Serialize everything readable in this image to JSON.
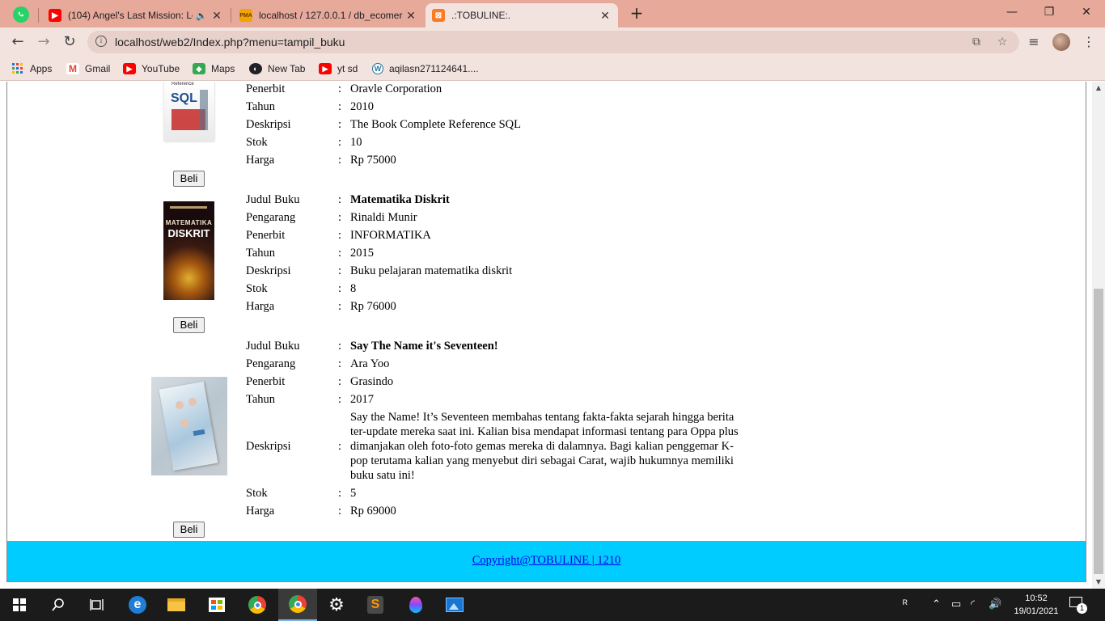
{
  "browser": {
    "tabs": [
      {
        "title": "(104) Angel's Last Mission: Lo",
        "favicon": "youtube-icon"
      },
      {
        "title": "localhost / 127.0.0.1 / db_ecomer",
        "favicon": "phpmyadmin-icon"
      },
      {
        "title": ".:TOBULINE:.",
        "favicon": "xampp-icon"
      }
    ],
    "url": "localhost/web2/Index.php?menu=tampil_buku",
    "bookmarks": [
      {
        "label": "Apps",
        "icon": "apps-grid-icon"
      },
      {
        "label": "Gmail",
        "icon": "gmail-icon"
      },
      {
        "label": "YouTube",
        "icon": "youtube-icon"
      },
      {
        "label": "Maps",
        "icon": "maps-icon"
      },
      {
        "label": "New Tab",
        "icon": "globe-icon"
      },
      {
        "label": "yt sd",
        "icon": "youtube-icon"
      },
      {
        "label": "aqilasn271124641....",
        "icon": "wordpress-icon"
      }
    ]
  },
  "books": [
    {
      "fields": [
        {
          "label": "Penerbit",
          "value": "Oravle Corporation"
        },
        {
          "label": "Tahun",
          "value": "2010"
        },
        {
          "label": "Deskripsi",
          "value": "The Book Complete Reference SQL"
        },
        {
          "label": "Stok",
          "value": "10"
        },
        {
          "label": "Harga",
          "value": "Rp 75000"
        }
      ],
      "cover_text": "SQL",
      "cover_small": "Reference",
      "buy_label": "Beli"
    },
    {
      "fields": [
        {
          "label": "Judul Buku",
          "value": "Matematika Diskrit"
        },
        {
          "label": "Pengarang",
          "value": "Rinaldi Munir"
        },
        {
          "label": "Penerbit",
          "value": "INFORMATIKA"
        },
        {
          "label": "Tahun",
          "value": "2015"
        },
        {
          "label": "Deskripsi",
          "value": "Buku pelajaran matematika diskrit"
        },
        {
          "label": "Stok",
          "value": "8"
        },
        {
          "label": "Harga",
          "value": "Rp 76000"
        }
      ],
      "cover_text": "MATEMATIKA",
      "cover_text2": "DISKRIT",
      "buy_label": "Beli"
    },
    {
      "fields": [
        {
          "label": "Judul Buku",
          "value": "Say The Name it's Seventeen!"
        },
        {
          "label": "Pengarang",
          "value": "Ara Yoo"
        },
        {
          "label": "Penerbit",
          "value": "Grasindo"
        },
        {
          "label": "Tahun",
          "value": "2017"
        },
        {
          "label": "Deskripsi",
          "value": "Say the Name! It’s Seventeen membahas tentang fakta-fakta sejarah hingga berita ter-update mereka saat ini. Kalian bisa mendapat informasi tentang para Oppa plus dimanjakan oleh foto-foto gemas mereka di dalamnya. Bagi kalian penggemar K-pop terutama kalian yang menyebut diri sebagai Carat, wajib hukumnya memiliki buku satu ini!"
        },
        {
          "label": "Stok",
          "value": "5"
        },
        {
          "label": "Harga",
          "value": "Rp 69000"
        }
      ],
      "buy_label": "Beli"
    }
  ],
  "colon": ":",
  "footer": {
    "text": "Copyright@TOBULINE | 1210"
  },
  "taskbar": {
    "time": "10:52",
    "date": "19/01/2021",
    "notifications": "1"
  },
  "colors": {
    "footer_bg": "#00ccff",
    "tab_strip": "#e6a99a",
    "toolbar": "#f3e3de"
  }
}
